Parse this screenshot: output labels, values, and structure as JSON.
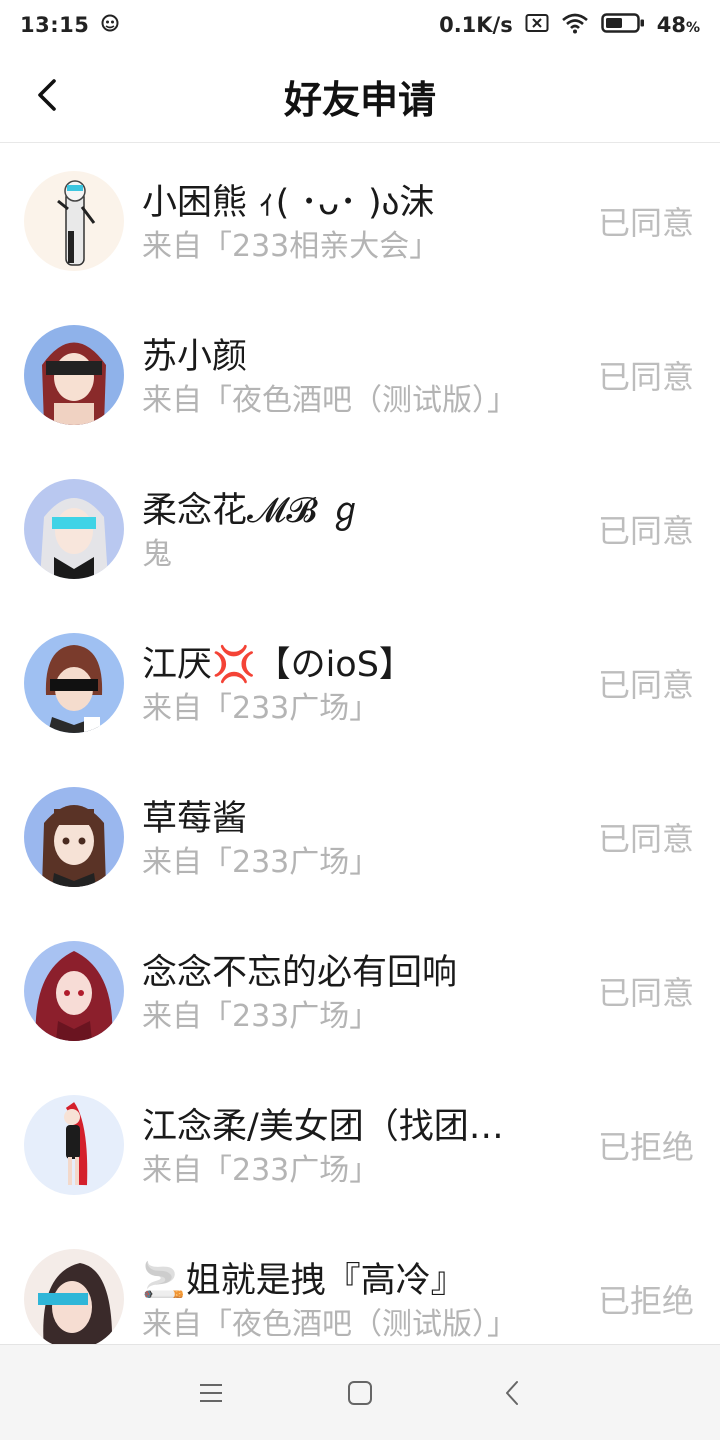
{
  "status_bar": {
    "time": "13:15",
    "net_speed": "0.1K/s",
    "battery": "48",
    "battery_unit": "%",
    "icons": [
      "notification-icon",
      "sim-off-icon",
      "wifi-icon",
      "battery-icon"
    ]
  },
  "header": {
    "title": "好友申请",
    "back_icon": "chevron-left-icon"
  },
  "requests": [
    {
      "name": "小困熊 ｨ( ･ᴗ･ )ა沫",
      "source": "来自「233相亲大会」",
      "status": "已同意"
    },
    {
      "name": "苏小颜",
      "source": "来自「夜色酒吧（测试版）」",
      "status": "已同意"
    },
    {
      "name": "柔念花𝓜𝓑 ℊ",
      "source": "鬼",
      "status": "已同意"
    },
    {
      "name": "江厌💢【のioS】",
      "source": "来自「233广场」",
      "status": "已同意"
    },
    {
      "name": "草莓酱",
      "source": "来自「233广场」",
      "status": "已同意"
    },
    {
      "name": "念念不忘的必有回响",
      "source": "来自「233广场」",
      "status": "已同意"
    },
    {
      "name": "江念柔/美女团（找团…",
      "source": "来自「233广场」",
      "status": "已拒绝"
    },
    {
      "name": "🚬姐就是拽『高冷』",
      "source": "来自「夜色酒吧（测试版）」",
      "status": "已拒绝"
    }
  ],
  "colors": {
    "status_text": "#bdbdbd",
    "source_text": "#b4b4b4",
    "name_text": "#1a1a1a"
  },
  "nav_bar": {
    "icons": [
      "menu-icon",
      "home-square-icon",
      "back-triangle-icon"
    ]
  }
}
